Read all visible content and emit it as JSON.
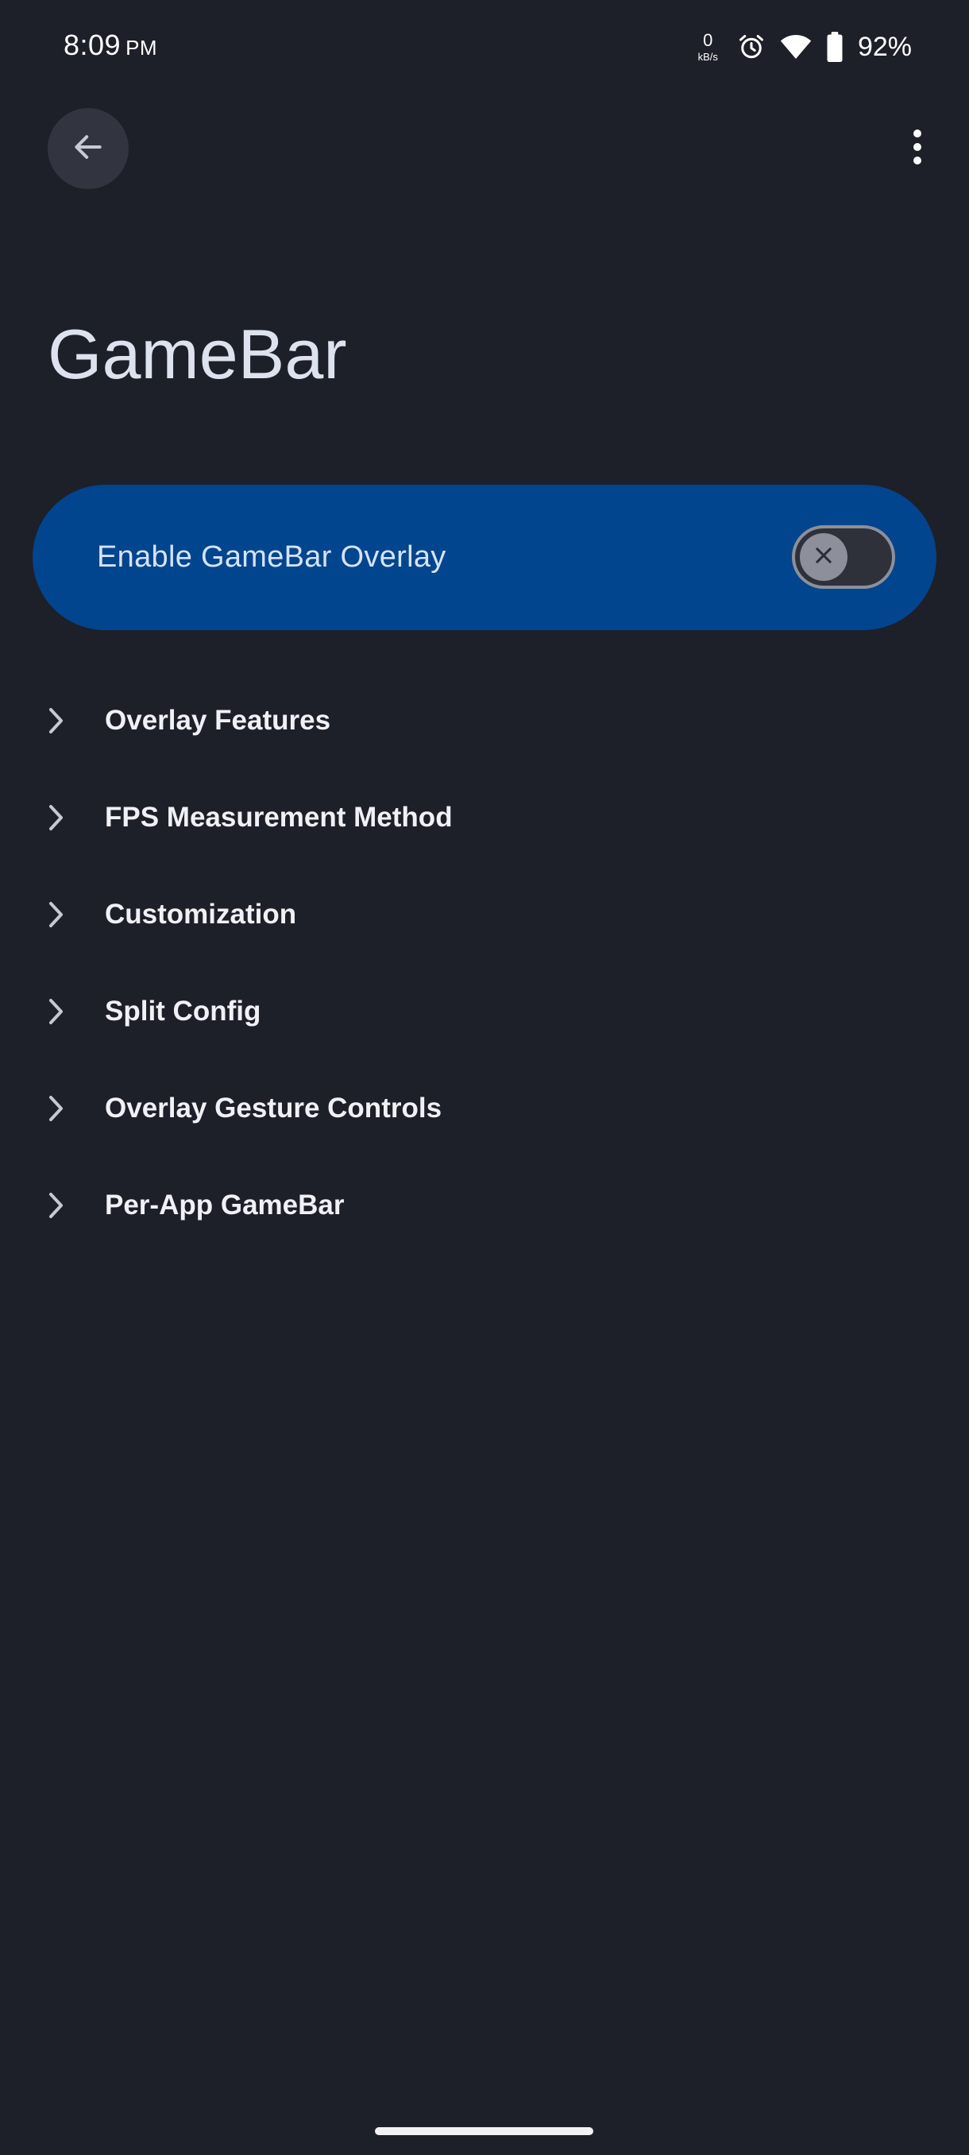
{
  "status_bar": {
    "time": "8:09",
    "ampm": "PM",
    "net_speed_value": "0",
    "net_speed_unit": "kB/s",
    "battery_percent": "92%",
    "icons": [
      "alarm-icon",
      "wifi-icon",
      "battery-icon"
    ]
  },
  "app_bar": {
    "back_icon": "arrow-back-icon",
    "more_icon": "more-vert-icon"
  },
  "page": {
    "title": "GameBar"
  },
  "main_switch": {
    "label": "Enable GameBar Overlay",
    "checked": false,
    "thumb_icon": "close-icon"
  },
  "categories": [
    {
      "label": "Overlay Features"
    },
    {
      "label": "FPS Measurement Method"
    },
    {
      "label": "Customization"
    },
    {
      "label": "Split Config"
    },
    {
      "label": "Overlay Gesture Controls"
    },
    {
      "label": "Per-App GameBar"
    }
  ],
  "colors": {
    "background": "#1d2029",
    "switch_card": "#00458d",
    "switch_label": "#d4e3ff",
    "toggle_track": "#2e3139",
    "toggle_outline": "#8d909a",
    "back_button_bg": "#32353f"
  }
}
